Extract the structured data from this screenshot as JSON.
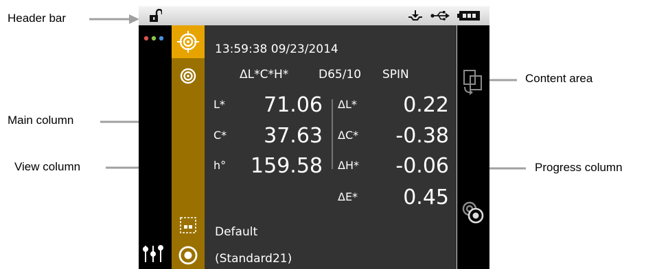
{
  "callouts": {
    "header_bar": "Header bar",
    "main_column": "Main column",
    "view_column": "View column",
    "content_area": "Content area",
    "progress_column": "Progress column"
  },
  "colors": {
    "view_column": "#9a7100",
    "active_view_tab": "#e7a400",
    "content_bg": "#333333",
    "header_bg": "#dcdcdc"
  },
  "header": {
    "icons": [
      "unlock-icon",
      "download-tray-icon",
      "usb-icon",
      "battery-icon"
    ]
  },
  "main_column": {
    "icons": [
      "dots-menu-icon",
      "sliders-icon"
    ]
  },
  "view_column": {
    "icons": [
      "target-crosshair-icon",
      "target-icon",
      "layout-icon",
      "measure-circle-icon"
    ]
  },
  "progress_column": {
    "icons": [
      "compare-icon",
      "target-pair-icon"
    ]
  },
  "content": {
    "timestamp": "13:59:38 09/23/2014",
    "delta_header": "ΔL*C*H*",
    "illuminant": "D65/10",
    "mode": "SPIN",
    "rows": [
      {
        "label": "L*",
        "value": "71.06",
        "delta_label": "ΔL*",
        "delta_value": "0.22"
      },
      {
        "label": "C*",
        "value": "37.63",
        "delta_label": "ΔC*",
        "delta_value": "-0.38"
      },
      {
        "label": "h°",
        "value": "159.58",
        "delta_label": "ΔH*",
        "delta_value": "-0.06"
      },
      {
        "label": "",
        "value": "",
        "delta_label": "ΔE*",
        "delta_value": "0.45"
      }
    ],
    "standard_name": "Default",
    "standard_id": "(Standard21)"
  }
}
